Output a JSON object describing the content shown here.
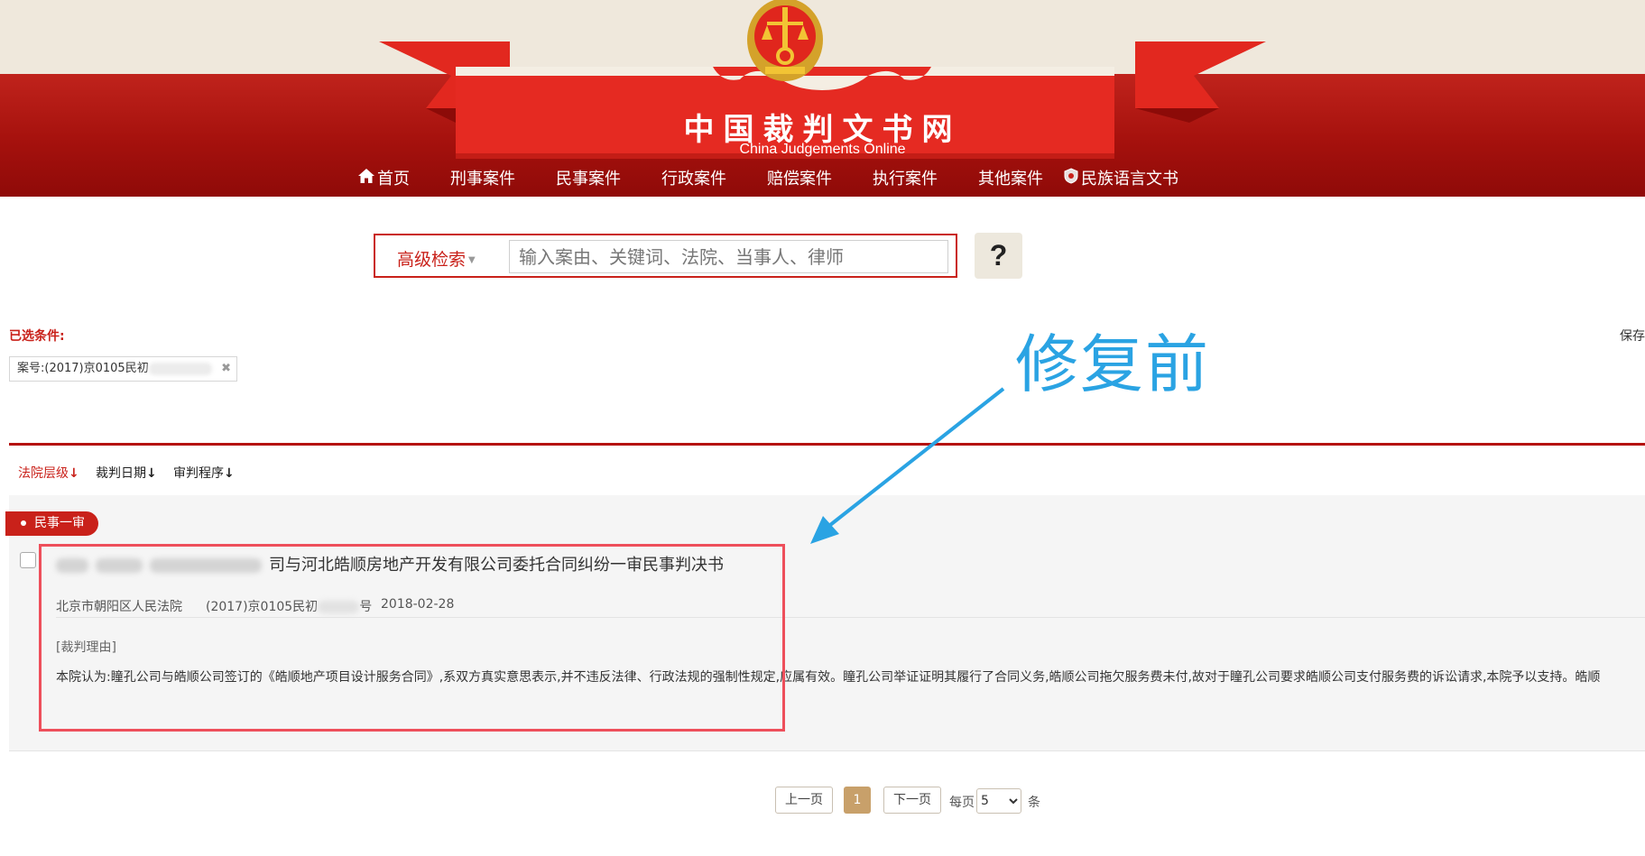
{
  "header": {
    "title": "中国裁判文书网",
    "subtitle": "China Judgements Online"
  },
  "nav": [
    {
      "label": "首页",
      "icon": "home-icon"
    },
    {
      "label": "刑事案件"
    },
    {
      "label": "民事案件"
    },
    {
      "label": "行政案件"
    },
    {
      "label": "赔偿案件"
    },
    {
      "label": "执行案件"
    },
    {
      "label": "其他案件"
    },
    {
      "label": "民族语言文书",
      "icon": "shield-icon"
    }
  ],
  "search": {
    "advanced_label": "高级检索",
    "placeholder": "输入案由、关键词、法院、当事人、律师",
    "help": "?"
  },
  "conditions": {
    "label": "已选条件:",
    "save": "保存",
    "tag_prefix": "案号:(2017)京0105民初"
  },
  "sort": [
    {
      "label": "法院层级",
      "arrow": "↓"
    },
    {
      "label": "裁判日期",
      "arrow": "↓"
    },
    {
      "label": "审判程序",
      "arrow": "↓"
    }
  ],
  "result": {
    "badge": "民事一审",
    "title_visible": "司与河北皓顺房地产开发有限公司委托合同纠纷一审民事判决书",
    "court": "北京市朝阳区人民法院",
    "case_no_prefix": "(2017)京0105民初",
    "case_no_suffix": "号",
    "date": "2018-02-28",
    "reason_label": "[裁判理由]",
    "reason_text": "本院认为:瞳孔公司与皓顺公司签订的《皓顺地产项目设计服务合同》,系双方真实意思表示,并不违反法律、行政法规的强制性规定,应属有效。瞳孔公司举证证明其履行了合同义务,皓顺公司拖欠服务费未付,故对于瞳孔公司要求皓顺公司支付服务费的诉讼请求,本院予以支持。皓顺"
  },
  "annotation": {
    "text": "修复前"
  },
  "pagination": {
    "prev": "上一页",
    "current": "1",
    "next": "下一页",
    "per_page_label": "每页",
    "per_page_value": "5",
    "unit": "条"
  },
  "colors": {
    "brand_red": "#c9211a",
    "annotation_blue": "#2aa3e3",
    "highlight_red": "#ee4f5b",
    "page_gold": "#c8a06a"
  }
}
